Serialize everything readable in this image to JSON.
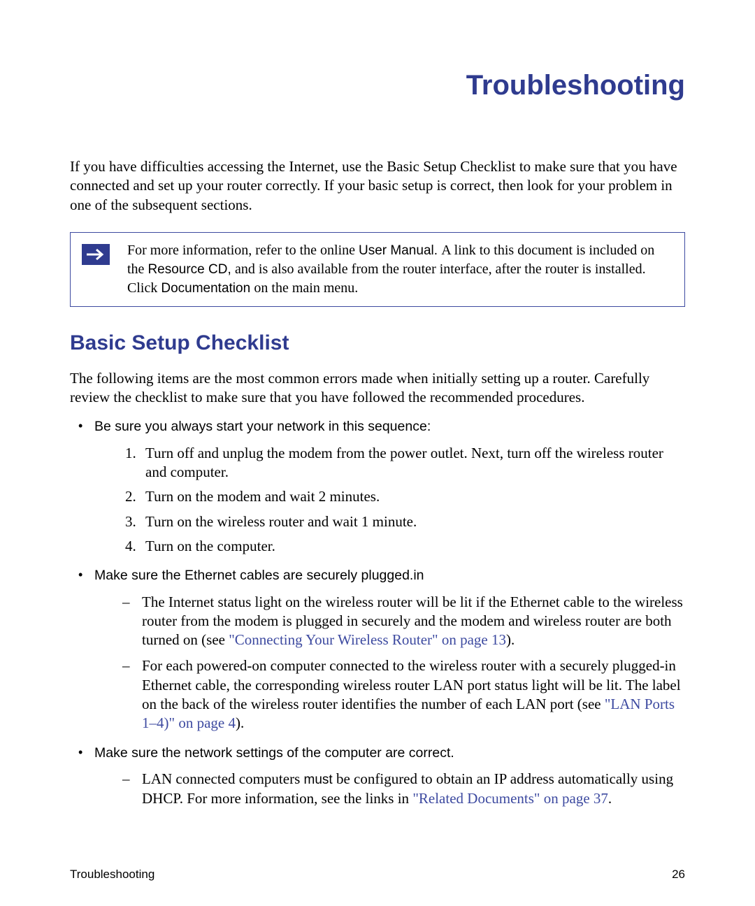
{
  "title": "Troubleshooting",
  "intro": "If you have difficulties accessing the Internet, use the Basic Setup Checklist to make sure that you have connected and set up your router correctly. If your basic setup is correct, then look for your problem in one of the subsequent sections.",
  "note": {
    "p1a": "For more information, refer to the online ",
    "p1b_label": "User Manual. ",
    "p1c": "A link to this document is included on the ",
    "p1d_label": "Resource CD, ",
    "p1e": "and is also available from the router interface, after the router is installed. Click ",
    "p1f_label": "Documentation ",
    "p1g": "on the main menu."
  },
  "section_title": "Basic Setup Checklist",
  "section_intro": "The following items are the most common errors made when initially setting up a router. Carefully review the checklist to make sure that you have followed the recommended procedures.",
  "bullets": {
    "b1": "Be sure you always start your network in this sequence:",
    "b1_steps": [
      "Turn off and unplug the modem from the power outlet. Next, turn off the wireless router and computer.",
      "Turn on the modem and wait 2 minutes.",
      "Turn on the wireless router and wait 1 minute.",
      "Turn on the computer."
    ],
    "b2": "Make sure the Ethernet cables are securely plugged.in",
    "b2_dash1_a": "The Internet status light on the wireless router will be lit if the Ethernet cable to the wireless router from the modem is plugged in securely and the modem and wireless router are both turned on (see ",
    "b2_dash1_link": "\"Connecting Your Wireless Router\" on page 13",
    "b2_dash1_b": ").",
    "b2_dash2_a": "For each powered-on computer connected to the wireless router with a securely plugged-in Ethernet cable, the corresponding wireless router LAN port status light will be lit. The label on the back of the wireless router identifies the number of each LAN port (see ",
    "b2_dash2_link": "\"LAN Ports 1–4)\" on page 4",
    "b2_dash2_b": ").",
    "b3": "Make sure the network settings of the computer are correct.",
    "b3_dash1_a": "LAN connected computers ",
    "b3_dash1_must": "must ",
    "b3_dash1_b": "be configured to obtain an IP address automatically using DHCP. For more information, see the links in  ",
    "b3_dash1_link": "\"Related Documents\" on page 37",
    "b3_dash1_c": "."
  },
  "footer": {
    "left": "Troubleshooting",
    "right": "26"
  }
}
